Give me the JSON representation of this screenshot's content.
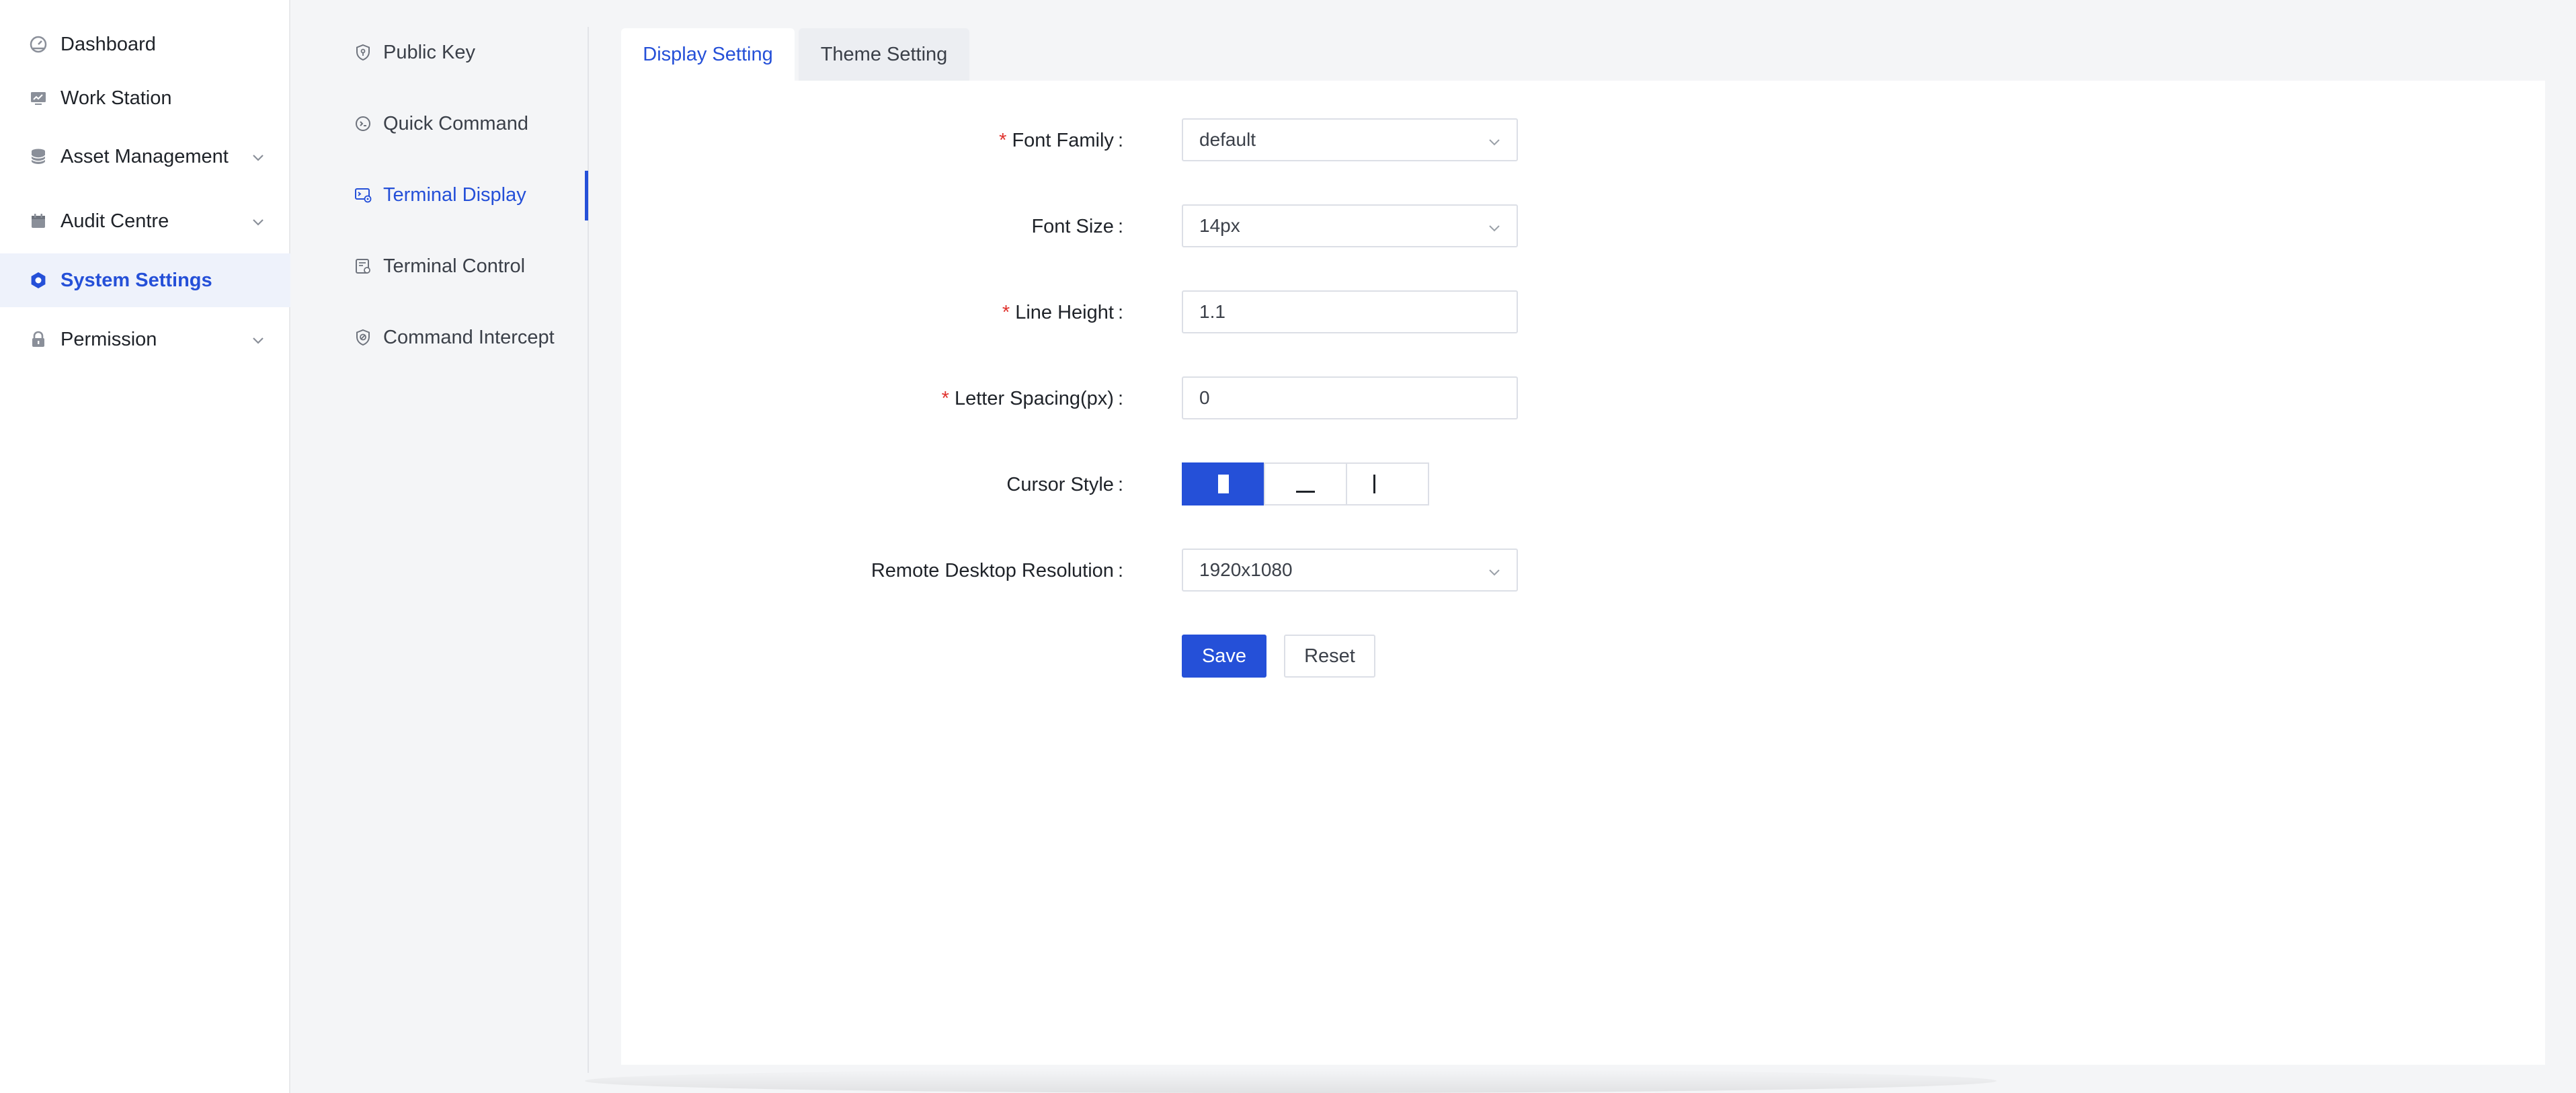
{
  "sidebar": {
    "items": [
      {
        "label": "Dashboard",
        "icon": "dashboard-icon",
        "has_submenu": false,
        "active": false
      },
      {
        "label": "Work Station",
        "icon": "workstation-icon",
        "has_submenu": false,
        "active": false
      },
      {
        "label": "Asset Management",
        "icon": "database-icon",
        "has_submenu": true,
        "active": false
      },
      {
        "label": "Audit Centre",
        "icon": "calendar-icon",
        "has_submenu": true,
        "active": false
      },
      {
        "label": "System Settings",
        "icon": "settings-icon",
        "has_submenu": false,
        "active": true
      },
      {
        "label": "Permission",
        "icon": "lock-icon",
        "has_submenu": true,
        "active": false
      }
    ]
  },
  "submenu": {
    "items": [
      {
        "label": "Public Key",
        "icon": "key-shield-icon",
        "active": false
      },
      {
        "label": "Quick Command",
        "icon": "command-icon",
        "active": false
      },
      {
        "label": "Terminal Display",
        "icon": "terminal-display-icon",
        "active": true
      },
      {
        "label": "Terminal Control",
        "icon": "terminal-control-icon",
        "active": false
      },
      {
        "label": "Command Intercept",
        "icon": "intercept-shield-icon",
        "active": false
      }
    ]
  },
  "tabs": [
    {
      "label": "Display Setting",
      "active": true
    },
    {
      "label": "Theme Setting",
      "active": false
    }
  ],
  "form": {
    "font_family": {
      "label": "Font Family",
      "required": true,
      "value": "default"
    },
    "font_size": {
      "label": "Font Size",
      "required": false,
      "value": "14px"
    },
    "line_height": {
      "label": "Line Height",
      "required": true,
      "value": "1.1"
    },
    "letter_spacing": {
      "label": "Letter Spacing(px)",
      "required": true,
      "value": "0"
    },
    "cursor_style": {
      "label": "Cursor Style",
      "options": [
        "block",
        "underline",
        "bar"
      ],
      "selected": "block"
    },
    "resolution": {
      "label": "Remote Desktop Resolution",
      "value": "1920x1080"
    },
    "colon": ":",
    "required_mark": "*",
    "save_label": "Save",
    "reset_label": "Reset"
  },
  "colors": {
    "accent": "#2550d8",
    "required": "#e0322d",
    "active_bg": "#eef2fb"
  }
}
